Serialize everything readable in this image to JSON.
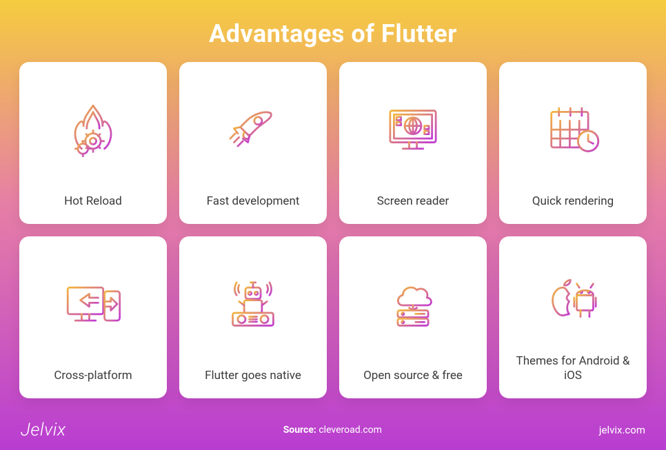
{
  "title": "Advantages of Flutter",
  "cards": [
    {
      "label": "Hot Reload",
      "icon": "flame-gear-icon"
    },
    {
      "label": "Fast development",
      "icon": "rocket-icon"
    },
    {
      "label": "Screen reader",
      "icon": "monitor-globe-icon"
    },
    {
      "label": "Quick rendering",
      "icon": "calendar-clock-icon"
    },
    {
      "label": "Cross-platform",
      "icon": "monitor-phone-sync-icon"
    },
    {
      "label": "Flutter goes native",
      "icon": "robot-dj-icon"
    },
    {
      "label": "Open source & free",
      "icon": "cloud-server-icon"
    },
    {
      "label": "Themes for Android & iOS",
      "icon": "apple-android-icon"
    }
  ],
  "footer": {
    "brand": "Jelvix",
    "source_prefix": "Source:",
    "source_value": "cleveroad.com",
    "site": "jelvix.com"
  },
  "colors": {
    "grad_start": "#f5cc3f",
    "grad_mid": "#e67fa5",
    "grad_end": "#b83dd1",
    "icon_a": "#f3b53d",
    "icon_b": "#c23bd3"
  }
}
